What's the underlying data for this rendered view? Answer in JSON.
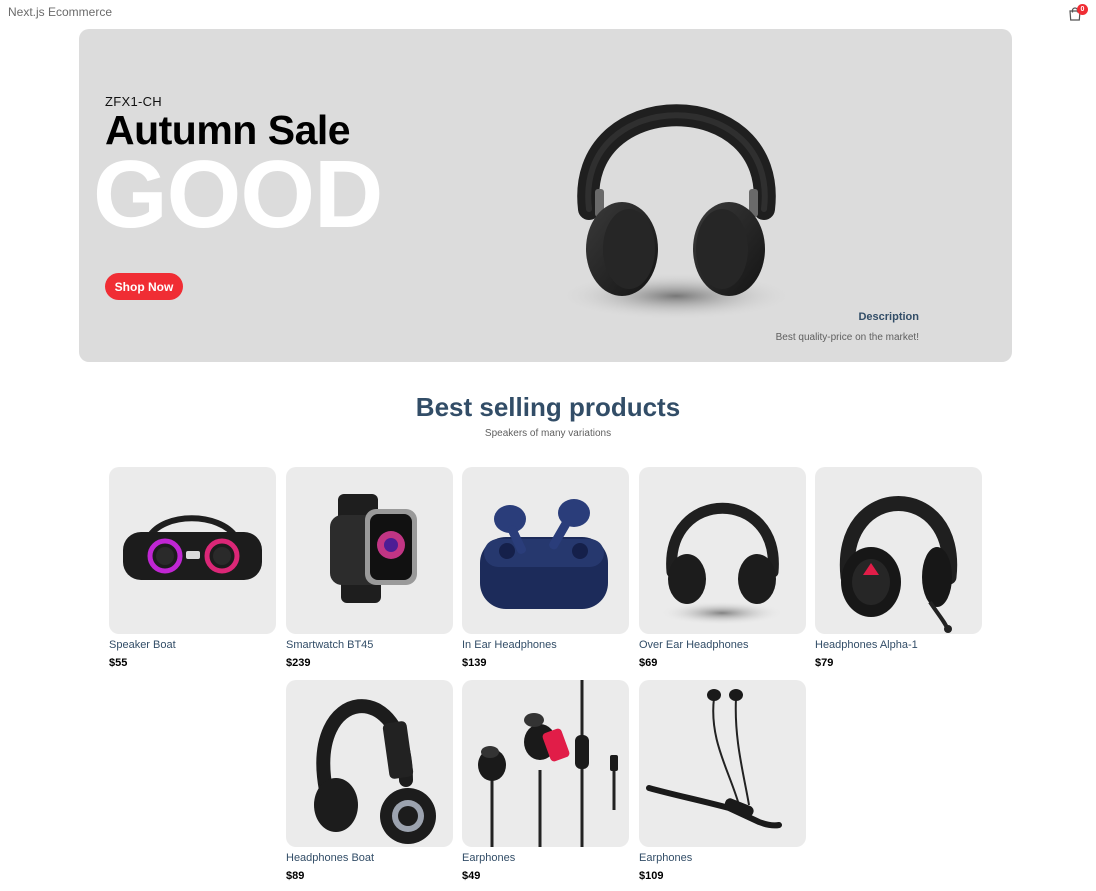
{
  "navbar": {
    "logo": "Next.js Ecommerce",
    "cart_count": "0"
  },
  "hero": {
    "small_text": "ZFX1-CH",
    "mid_text": "Autumn Sale",
    "large_text": "GOOD",
    "button_label": "Shop Now",
    "desc_title": "Description",
    "desc_text": "Best quality-price on the market!"
  },
  "section": {
    "title": "Best selling products",
    "subtitle": "Speakers of many variations"
  },
  "products": [
    {
      "name": "Speaker Boat",
      "price": "$55",
      "icon": "speaker"
    },
    {
      "name": "Smartwatch BT45",
      "price": "$239",
      "icon": "smartwatch"
    },
    {
      "name": "In Ear Headphones",
      "price": "$139",
      "icon": "earbuds"
    },
    {
      "name": "Over Ear Headphones",
      "price": "$69",
      "icon": "headphones"
    },
    {
      "name": "Headphones Alpha-1",
      "price": "$79",
      "icon": "headset"
    },
    {
      "name": "Headphones Boat",
      "price": "$89",
      "icon": "headphones-boat"
    },
    {
      "name": "Earphones",
      "price": "$49",
      "icon": "earphones"
    },
    {
      "name": "Earphones",
      "price": "$109",
      "icon": "neckband"
    }
  ],
  "colors": {
    "accent": "#f02d34",
    "text": "#324d67",
    "hero_bg": "#dcdcdc",
    "card_bg": "#ebebeb"
  }
}
